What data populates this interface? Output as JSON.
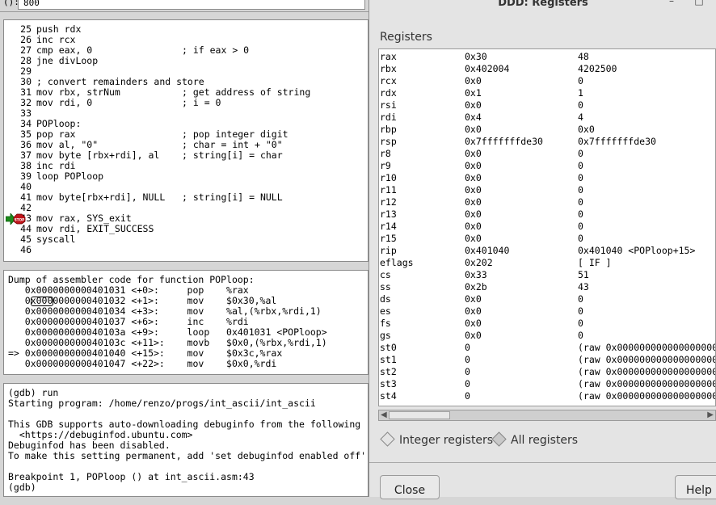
{
  "ddd_main": {
    "argument_field": {
      "label": "():",
      "value": "800"
    },
    "source": {
      "lines": [
        {
          "num": "25",
          "code": "push rdx"
        },
        {
          "num": "26",
          "code": "inc rcx"
        },
        {
          "num": "27",
          "code": "cmp eax, 0                ; if eax > 0"
        },
        {
          "num": "28",
          "code": "jne divLoop"
        },
        {
          "num": "29",
          "code": ""
        },
        {
          "num": "30",
          "code": "; convert remainders and store"
        },
        {
          "num": "31",
          "code": "mov rbx, strNum           ; get address of string"
        },
        {
          "num": "32",
          "code": "mov rdi, 0                ; i = 0"
        },
        {
          "num": "33",
          "code": ""
        },
        {
          "num": "34",
          "code": "POPloop:"
        },
        {
          "num": "35",
          "code": "pop rax                   ; pop integer digit"
        },
        {
          "num": "36",
          "code": "mov al, \"0\"               ; char = int + \"0\""
        },
        {
          "num": "37",
          "code": "mov byte [rbx+rdi], al    ; string[i] = char"
        },
        {
          "num": "38",
          "code": "inc rdi"
        },
        {
          "num": "39",
          "code": "loop POPloop"
        },
        {
          "num": "40",
          "code": ""
        },
        {
          "num": "41",
          "code": "mov byte[rbx+rdi], NULL   ; string[i] = NULL"
        },
        {
          "num": "42",
          "code": ""
        },
        {
          "num": "43",
          "code": "mov rax, SYS_exit"
        },
        {
          "num": "44",
          "code": "mov rdi, EXIT_SUCCESS"
        },
        {
          "num": "45",
          "code": "syscall"
        },
        {
          "num": "46",
          "code": ""
        }
      ],
      "breakpoint_marker": "STOP"
    },
    "disassembly": {
      "header": "Dump of assembler code for function POPloop:",
      "lines": [
        "   0x0000000000401031 <+0>:     pop    %rax",
        "   0x0000000000401032 <+1>:     mov    $0x30,%al",
        "   0x0000000000401034 <+3>:     mov    %al,(%rbx,%rdi,1)",
        "   0x0000000000401037 <+6>:     inc    %rdi",
        "   0x000000000040103a <+9>:     loop   0x401031 <POPloop>",
        "   0x000000000040103c <+11>:    movb   $0x0,(%rbx,%rdi,1)",
        "=> 0x0000000000401040 <+15>:    mov    $0x3c,%rax",
        "   0x0000000000401047 <+22>:    mov    $0x0,%rdi"
      ]
    },
    "console": {
      "lines": [
        "(gdb) run",
        "Starting program: /home/renzo/progs/int_ascii/int_ascii",
        "",
        "This GDB supports auto-downloading debuginfo from the following",
        "  <https://debuginfod.ubuntu.com>",
        "Debuginfod has been disabled.",
        "To make this setting permanent, add 'set debuginfod enabled off'",
        "",
        "Breakpoint 1, POPloop () at int_ascii.asm:43",
        "(gdb)"
      ]
    }
  },
  "registers_dialog": {
    "title": "DDD: Registers",
    "minimize_glyph": "–",
    "maximize_glyph": "□",
    "section_label": "Registers",
    "registers": [
      {
        "name": "rax",
        "hex": "0x30",
        "natural": "48"
      },
      {
        "name": "rbx",
        "hex": "0x402004",
        "natural": "4202500"
      },
      {
        "name": "rcx",
        "hex": "0x0",
        "natural": "0"
      },
      {
        "name": "rdx",
        "hex": "0x1",
        "natural": "1"
      },
      {
        "name": "rsi",
        "hex": "0x0",
        "natural": "0"
      },
      {
        "name": "rdi",
        "hex": "0x4",
        "natural": "4"
      },
      {
        "name": "rbp",
        "hex": "0x0",
        "natural": "0x0"
      },
      {
        "name": "rsp",
        "hex": "0x7fffffffde30",
        "natural": "0x7fffffffde30"
      },
      {
        "name": "r8",
        "hex": "0x0",
        "natural": "0"
      },
      {
        "name": "r9",
        "hex": "0x0",
        "natural": "0"
      },
      {
        "name": "r10",
        "hex": "0x0",
        "natural": "0"
      },
      {
        "name": "r11",
        "hex": "0x0",
        "natural": "0"
      },
      {
        "name": "r12",
        "hex": "0x0",
        "natural": "0"
      },
      {
        "name": "r13",
        "hex": "0x0",
        "natural": "0"
      },
      {
        "name": "r14",
        "hex": "0x0",
        "natural": "0"
      },
      {
        "name": "r15",
        "hex": "0x0",
        "natural": "0"
      },
      {
        "name": "rip",
        "hex": "0x401040",
        "natural": "0x401040 <POPloop+15>"
      },
      {
        "name": "eflags",
        "hex": "0x202",
        "natural": "[ IF ]"
      },
      {
        "name": "cs",
        "hex": "0x33",
        "natural": "51"
      },
      {
        "name": "ss",
        "hex": "0x2b",
        "natural": "43"
      },
      {
        "name": "ds",
        "hex": "0x0",
        "natural": "0"
      },
      {
        "name": "es",
        "hex": "0x0",
        "natural": "0"
      },
      {
        "name": "fs",
        "hex": "0x0",
        "natural": "0"
      },
      {
        "name": "gs",
        "hex": "0x0",
        "natural": "0"
      },
      {
        "name": "st0",
        "hex": "0",
        "natural": "(raw 0x0000000000000000000"
      },
      {
        "name": "st1",
        "hex": "0",
        "natural": "(raw 0x0000000000000000000"
      },
      {
        "name": "st2",
        "hex": "0",
        "natural": "(raw 0x0000000000000000000"
      },
      {
        "name": "st3",
        "hex": "0",
        "natural": "(raw 0x0000000000000000000"
      },
      {
        "name": "st4",
        "hex": "0",
        "natural": "(raw 0x0000000000000000000"
      }
    ],
    "radio_integer": "Integer registers",
    "radio_all": "All registers",
    "selected_radio": "all",
    "close_label": "Close",
    "help_label": "Help"
  }
}
